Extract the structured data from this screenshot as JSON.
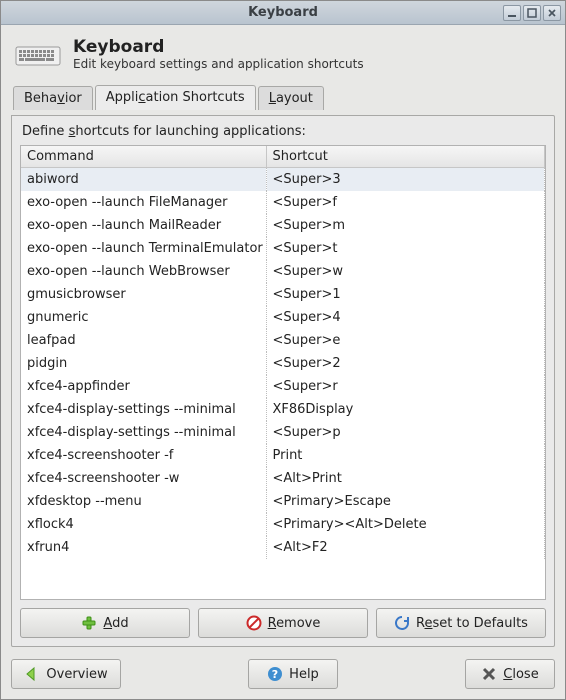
{
  "window": {
    "title": "Keyboard"
  },
  "header": {
    "title": "Keyboard",
    "subtitle": "Edit keyboard settings and application shortcuts"
  },
  "tabs": {
    "behavior": "Behavior",
    "shortcuts": "Application Shortcuts",
    "layout": "Layout"
  },
  "panel": {
    "label_pre": "Define ",
    "label_u": "s",
    "label_post": "hortcuts for launching applications:",
    "headers": {
      "command": "Command",
      "shortcut": "Shortcut"
    }
  },
  "rows": [
    {
      "command": "abiword",
      "shortcut": "<Super>3"
    },
    {
      "command": "exo-open --launch FileManager",
      "shortcut": "<Super>f"
    },
    {
      "command": "exo-open --launch MailReader",
      "shortcut": "<Super>m"
    },
    {
      "command": "exo-open --launch TerminalEmulator",
      "shortcut": "<Super>t"
    },
    {
      "command": "exo-open --launch WebBrowser",
      "shortcut": "<Super>w"
    },
    {
      "command": "gmusicbrowser",
      "shortcut": "<Super>1"
    },
    {
      "command": "gnumeric",
      "shortcut": "<Super>4"
    },
    {
      "command": "leafpad",
      "shortcut": "<Super>e"
    },
    {
      "command": "pidgin",
      "shortcut": "<Super>2"
    },
    {
      "command": "xfce4-appfinder",
      "shortcut": "<Super>r"
    },
    {
      "command": "xfce4-display-settings --minimal",
      "shortcut": "XF86Display"
    },
    {
      "command": "xfce4-display-settings --minimal",
      "shortcut": "<Super>p"
    },
    {
      "command": "xfce4-screenshooter -f",
      "shortcut": "Print"
    },
    {
      "command": "xfce4-screenshooter -w",
      "shortcut": "<Alt>Print"
    },
    {
      "command": "xfdesktop --menu",
      "shortcut": "<Primary>Escape"
    },
    {
      "command": "xflock4",
      "shortcut": "<Primary><Alt>Delete"
    },
    {
      "command": "xfrun4",
      "shortcut": "<Alt>F2"
    }
  ],
  "buttons": {
    "add": "Add",
    "remove": "Remove",
    "reset": "Reset to Defaults",
    "overview": "Overview",
    "help": "Help",
    "close": "Close"
  }
}
